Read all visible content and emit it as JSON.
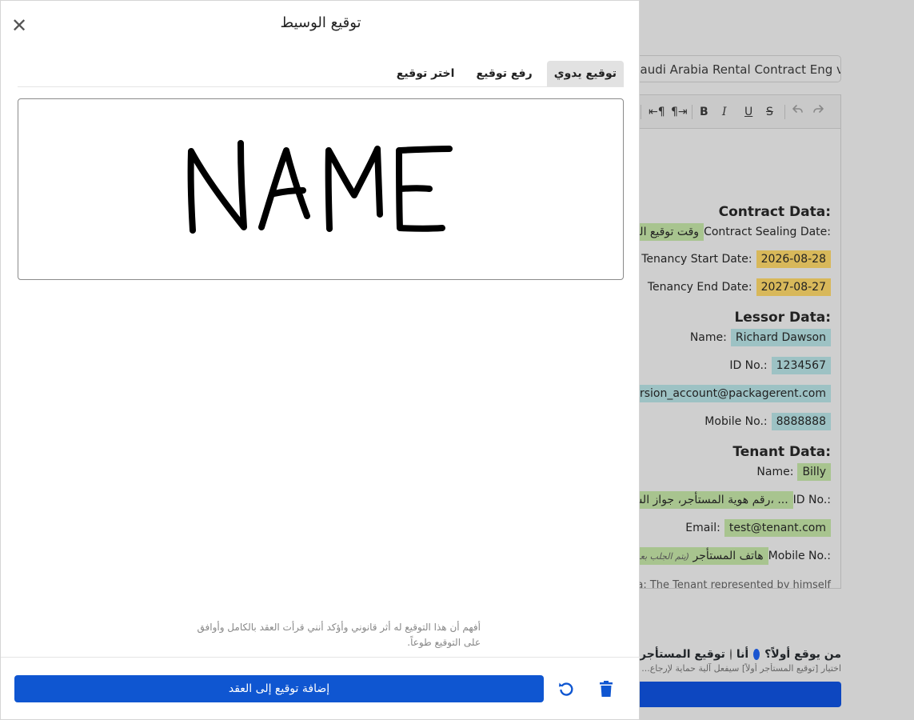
{
  "background": {
    "template_value": "Saudi Arabia Rental Contract Eng ver.)",
    "toolbar": [
      "⇤¶",
      "¶⇥",
      "B",
      "I",
      "U",
      "S"
    ],
    "contract_heading": "Contract Data:",
    "sealing_label": "Contract Sealing Date:",
    "sealing_value": "وقت توقيع المستأجر",
    "start_label": "Tenancy Start Date:",
    "start_value": "2026-08-28",
    "end_label": "Tenancy End Date:",
    "end_value": "2027-08-27",
    "lessor_heading": "Lessor Data:",
    "lessor_name_label": "Name:",
    "lessor_name_value": "Richard Dawson",
    "lessor_id_label": "ID No.:",
    "lessor_id_value": "1234567",
    "lessor_email_value": "trial_version_account@packagerent.com",
    "lessor_mobile_label": "Mobile No.:",
    "lessor_mobile_value": "8888888",
    "tenant_heading": "Tenant Data:",
    "tenant_name_label": "Name:",
    "tenant_name_value": "Billy",
    "tenant_id_label": "ID No.:",
    "tenant_id_value": "رقم هوية المستأجر، جواز السفر، ...",
    "tenant_email_label": "Email:",
    "tenant_email_value": "test@tenant.com",
    "tenant_mobile_label": "Mobile No.:",
    "tenant_mobile_value": "هاتف المستأجر",
    "tenant_mobile_note": "(يتم الجلب بعد...)",
    "rep_text": "Representative Data: The Tenant represented by himself",
    "who_first_label": "من يوقع أولاً؟",
    "who_option_me": "أنا",
    "who_option_tenant": "توقيع المستأجر بعد",
    "who_note": "اختيار [توقيع المستأجر أولاً] سيفعل آلية حماية لإرجاع..."
  },
  "modal": {
    "title": "توقيع الوسيط",
    "tabs": [
      {
        "label": "توقيع يدوي",
        "active": true
      },
      {
        "label": "رفع توقيع",
        "active": false
      },
      {
        "label": "اختر توقيع",
        "active": false
      }
    ],
    "consent_text": "أفهم أن هذا التوقيع له أثر قانوني وأؤكد أنني قرأت العقد بالكامل وأوافق على التوقيع طوعاً.",
    "add_button": "إضافة توقيع إلى العقد",
    "accent_color": "#0f56d1"
  }
}
